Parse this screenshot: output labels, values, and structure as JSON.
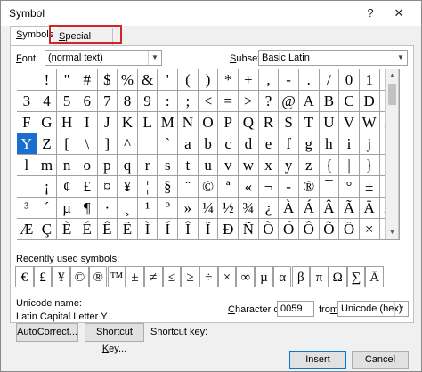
{
  "window": {
    "title": "Symbol",
    "help": "?",
    "close": "✕"
  },
  "tabs": [
    {
      "label_pre": "",
      "label_ul": "S",
      "label_post": "ymbols",
      "active": true
    },
    {
      "label_pre": "",
      "label_ul": "S",
      "label_post": "pecial Characters",
      "active": false
    }
  ],
  "font": {
    "label_pre": "",
    "label_ul": "F",
    "label_post": "ont:",
    "value": "(normal text)"
  },
  "subset": {
    "label_pre": "",
    "label_ul": "S",
    "label_post": "ubset:",
    "value": "Basic Latin"
  },
  "grid_rows": [
    [
      " ",
      "!",
      "\"",
      "#",
      "$",
      "%",
      "&",
      "'",
      "(",
      ")",
      "*",
      "+",
      ",",
      "-",
      ".",
      "/",
      "0",
      "1",
      "2"
    ],
    [
      "3",
      "4",
      "5",
      "6",
      "7",
      "8",
      "9",
      ":",
      ";",
      "<",
      "=",
      ">",
      "?",
      "@",
      "A",
      "B",
      "C",
      "D",
      "E"
    ],
    [
      "F",
      "G",
      "H",
      "I",
      "J",
      "K",
      "L",
      "M",
      "N",
      "O",
      "P",
      "Q",
      "R",
      "S",
      "T",
      "U",
      "V",
      "W",
      "X"
    ],
    [
      "Y",
      "Z",
      "[",
      "\\",
      "]",
      "^",
      "_",
      "`",
      "a",
      "b",
      "c",
      "d",
      "e",
      "f",
      "g",
      "h",
      "i",
      "j",
      "k"
    ],
    [
      "l",
      "m",
      "n",
      "o",
      "p",
      "q",
      "r",
      "s",
      "t",
      "u",
      "v",
      "w",
      "x",
      "y",
      "z",
      "{",
      "|",
      "}",
      "~"
    ],
    [
      " ",
      "¡",
      "¢",
      "£",
      "¤",
      "¥",
      "¦",
      "§",
      "¨",
      "©",
      "ª",
      "«",
      "¬",
      "-",
      "®",
      "¯",
      "°",
      "±",
      "²"
    ],
    [
      "³",
      "´",
      "µ",
      "¶",
      "·",
      "¸",
      "¹",
      "º",
      "»",
      "¼",
      "½",
      "¾",
      "¿",
      "À",
      "Á",
      "Â",
      "Ã",
      "Ä",
      "Å"
    ],
    [
      "Æ",
      "Ç",
      "È",
      "É",
      "Ê",
      "Ë",
      "Ì",
      "Í",
      "Î",
      "Ï",
      "Ð",
      "Ñ",
      "Ò",
      "Ó",
      "Ô",
      "Õ",
      "Ö",
      "×",
      "Ø"
    ]
  ],
  "selected_symbol": "Y",
  "recent_label_pre": "",
  "recent_label_ul": "R",
  "recent_label_post": "ecently used symbols:",
  "recent": [
    "€",
    "£",
    "¥",
    "©",
    "®",
    "™",
    "±",
    "≠",
    "≤",
    "≥",
    "÷",
    "×",
    "∞",
    "µ",
    "α",
    "β",
    "π",
    "Ω",
    "∑",
    "Ā"
  ],
  "unicode_name_label": "Unicode name:",
  "unicode_name": "Latin Capital Letter Y",
  "char_code": {
    "label_pre": "",
    "label_ul": "C",
    "label_post": "haracter code:",
    "value": "0059"
  },
  "from": {
    "label_pre": "fro",
    "label_ul": "m",
    "label_post": ":",
    "value": "Unicode (hex)"
  },
  "buttons": {
    "autocorrect_pre": "",
    "autocorrect_ul": "A",
    "autocorrect_post": "utoCorrect...",
    "shortcut_pre": "Shortcut ",
    "shortcut_ul": "K",
    "shortcut_post": "ey...",
    "insert": "Insert",
    "cancel": "Cancel"
  },
  "shortcut_key_label": "Shortcut key:",
  "colors": {
    "selection": "#1b6ecf",
    "highlight_box": "#d3242b"
  }
}
